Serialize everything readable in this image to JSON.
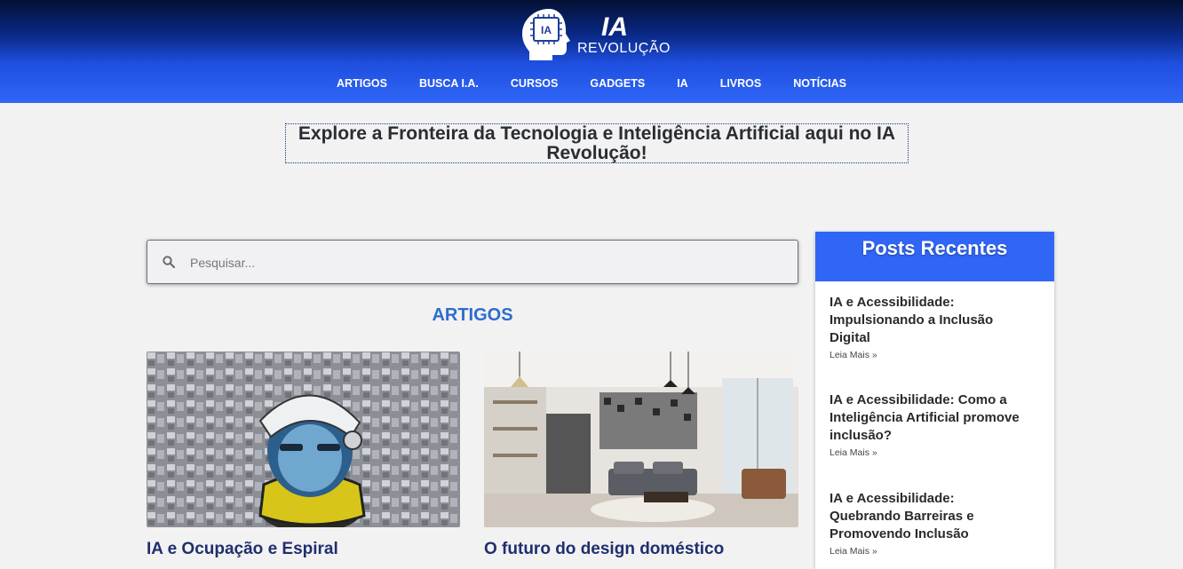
{
  "brand": {
    "logo_badge": "IA",
    "logo_mark": "IA",
    "name": "REVOLUÇÃO",
    "colors": {
      "header_dark": "#041033",
      "header_light": "#2f66f6",
      "accent": "#2d6cd0"
    }
  },
  "nav": {
    "items": [
      "ARTIGOS",
      "BUSCA I.A.",
      "CURSOS",
      "GADGETS",
      "IA",
      "LIVROS",
      "NOTÍCIAS"
    ]
  },
  "hero": {
    "line1": "Explore a Fronteira da Tecnologia e Inteligência Artificial aqui no IA",
    "line2": "Revolução!"
  },
  "search": {
    "placeholder": "Pesquisar...",
    "value": "",
    "icon": "search-icon"
  },
  "articles": {
    "heading": "ARTIGOS",
    "cards": [
      {
        "title": "IA e Ocupação e Espiral",
        "image": "robot-astronaut-over-city"
      },
      {
        "title": "O futuro do design doméstico",
        "image": "modern-living-room"
      }
    ]
  },
  "sidebar": {
    "heading": "Posts Recentes",
    "posts": [
      {
        "title": "IA e Acessibilidade: Impulsionando a Inclusão Digital",
        "more": "Leia Mais »"
      },
      {
        "title": "IA e Acessibilidade: Como a Inteligência Artificial promove inclusão?",
        "more": "Leia Mais »"
      },
      {
        "title": "IA e Acessibilidade: Quebrando Barreiras e Promovendo Inclusão",
        "more": "Leia Mais »"
      }
    ]
  }
}
